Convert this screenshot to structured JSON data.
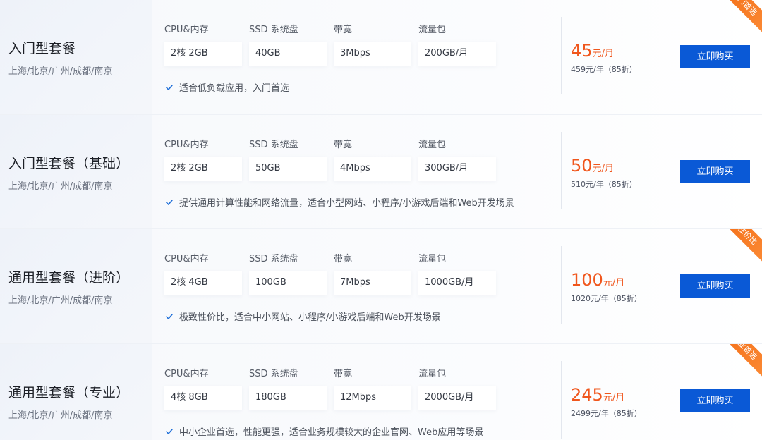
{
  "spec_headers": [
    "CPU&内存",
    "SSD 系统盘",
    "带宽",
    "流量包"
  ],
  "plans": [
    {
      "name": "入门型套餐",
      "regions": "上海/北京/广州/成都/南京",
      "specs": [
        "2核 2GB",
        "40GB",
        "3Mbps",
        "200GB/月"
      ],
      "feature": "适合低负载应用，入门首选",
      "price": "45",
      "price_unit": "元/月",
      "price_year": "459元/年（85折）",
      "buy_label": "立即购买",
      "badge": "入门首选"
    },
    {
      "name": "入门型套餐（基础）",
      "regions": "上海/北京/广州/成都/南京",
      "specs": [
        "2核 2GB",
        "50GB",
        "4Mbps",
        "300GB/月"
      ],
      "feature": "提供通用计算性能和网络流量，适合小型网站、小程序/小游戏后端和Web开发场景",
      "price": "50",
      "price_unit": "元/月",
      "price_year": "510元/年（85折）",
      "buy_label": "立即购买",
      "badge": ""
    },
    {
      "name": "通用型套餐（进阶）",
      "regions": "上海/北京/广州/成都/南京",
      "specs": [
        "2核 4GB",
        "100GB",
        "7Mbps",
        "1000GB/月"
      ],
      "feature": "极致性价比，适合中小网站、小程序/小游戏后端和Web开发场景",
      "price": "100",
      "price_unit": "元/月",
      "price_year": "1020元/年（85折）",
      "buy_label": "立即购买",
      "badge": "高性价比"
    },
    {
      "name": "通用型套餐（专业）",
      "regions": "上海/北京/广州/成都/南京",
      "specs": [
        "4核 8GB",
        "180GB",
        "12Mbps",
        "2000GB/月"
      ],
      "feature": "中小企业首选，性能更强，适合业务规模较大的企业官网、Web应用等场景",
      "price": "245",
      "price_unit": "元/月",
      "price_year": "2499元/年（85折）",
      "buy_label": "立即购买",
      "badge": "企业首选"
    }
  ],
  "colors": {
    "accent_blue": "#0a59d6",
    "price_orange": "#f0561c",
    "ribbon_orange": "#f36b13",
    "check_blue": "#1f6fd8"
  },
  "icons": {
    "check": "check-icon"
  }
}
